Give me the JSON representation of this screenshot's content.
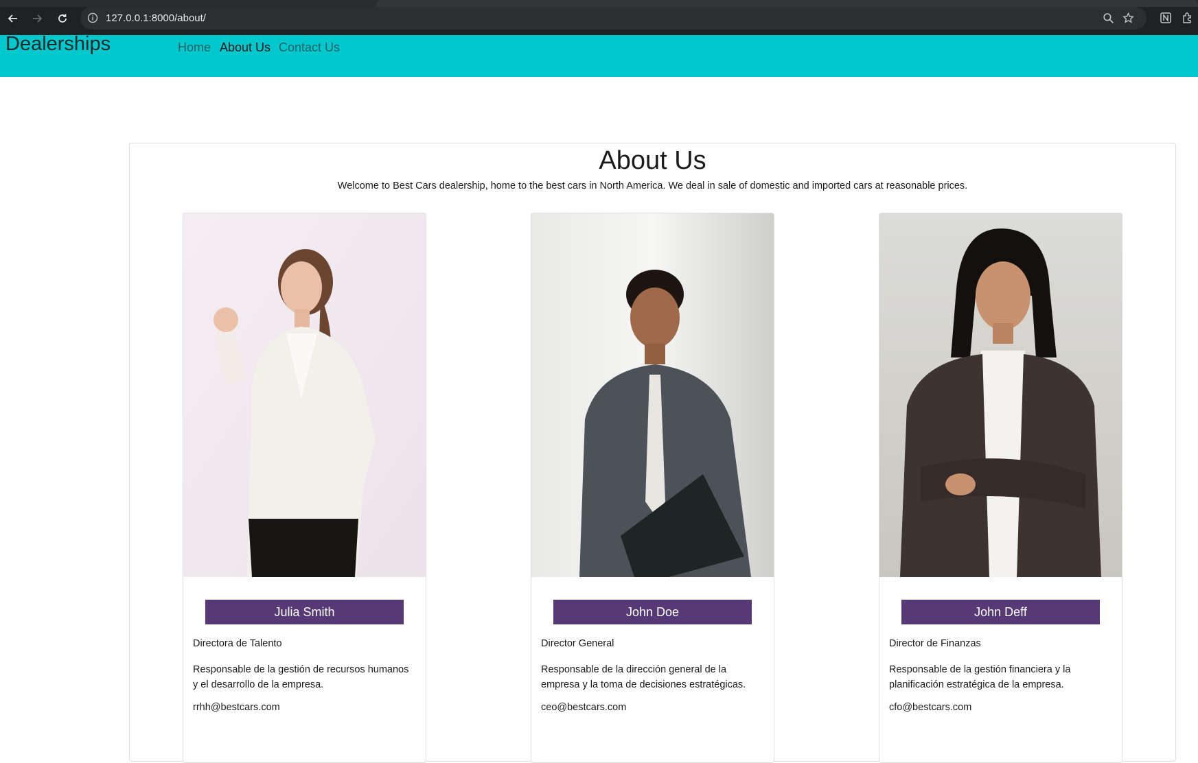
{
  "browser": {
    "url": "127.0.0.1:8000/about/"
  },
  "navbar": {
    "brand": "Dealerships",
    "links": [
      {
        "label": "Home",
        "active": false
      },
      {
        "label": "About Us",
        "active": true
      },
      {
        "label": "Contact Us",
        "active": false
      }
    ],
    "background": "#00c8cc"
  },
  "about": {
    "title": "About Us",
    "intro": "Welcome to Best Cars dealership, home to the best cars in North America. We deal in sale of domestic and imported cars at reasonable prices."
  },
  "team": [
    {
      "name": "Julia Smith",
      "role": "Directora de Talento",
      "description": "Responsable de la gestión de recursos humanos y el desarrollo de la empresa.",
      "email": "rrhh@bestcars.com"
    },
    {
      "name": "John Doe",
      "role": "Director General",
      "description": "Responsable de la dirección general de la empresa y la toma de decisiones estratégicas.",
      "email": "ceo@bestcars.com"
    },
    {
      "name": "John Deff",
      "role": "Director de Finanzas",
      "description": "Responsable de la gestión financiera y la planificación estratégica de la empresa.",
      "email": "cfo@bestcars.com"
    }
  ],
  "colors": {
    "name_bar": "#573a75"
  }
}
